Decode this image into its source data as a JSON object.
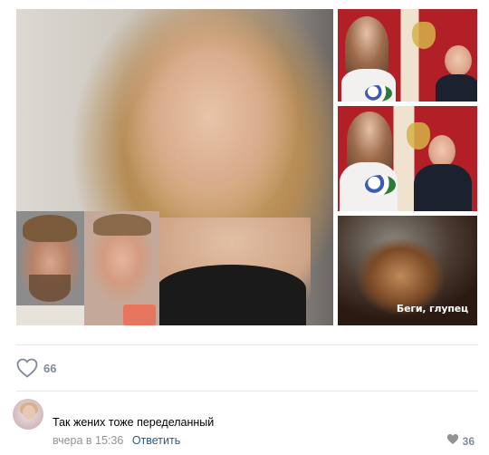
{
  "post": {
    "photos": [
      {
        "id": "main",
        "description_icon": "portrait-photo"
      },
      {
        "id": "wedding-1",
        "description_icon": "wedding-photo"
      },
      {
        "id": "wedding-2",
        "description_icon": "wedding-photo"
      },
      {
        "id": "meme",
        "caption": "Беги, глупец"
      }
    ],
    "likes": {
      "count": "66",
      "icon": "heart-outline-icon",
      "color": "#828a99"
    }
  },
  "comment": {
    "text": "Так жених тоже переделанный",
    "time": "вчера в 15:36",
    "reply_label": "Ответить",
    "likes": {
      "count": "36",
      "icon": "heart-filled-icon"
    }
  },
  "colors": {
    "link": "#2a5885",
    "muted": "#939393",
    "divider": "#e7e8ec"
  }
}
